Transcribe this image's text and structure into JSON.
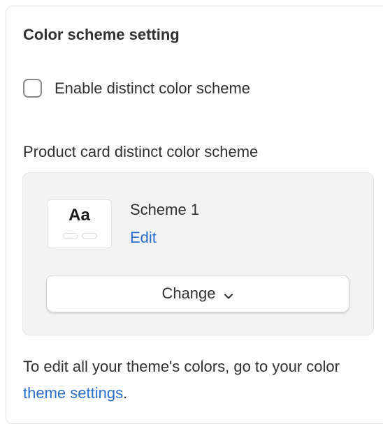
{
  "section": {
    "title": "Color scheme setting"
  },
  "enable_checkbox": {
    "label": "Enable distinct color scheme",
    "checked": false
  },
  "product_card": {
    "label": "Product card distinct color scheme",
    "preview_text": "Aa",
    "scheme_name": "Scheme 1",
    "edit_label": "Edit",
    "change_label": "Change"
  },
  "help": {
    "prefix": "To edit all your theme's colors, go to your color ",
    "link_text": "theme settings",
    "suffix": "."
  },
  "colors": {
    "link": "#2c6ecb",
    "card_background": "#f3f3f3",
    "text": "#303030"
  },
  "icons": {
    "change_chevron": "chevron-down-icon"
  }
}
